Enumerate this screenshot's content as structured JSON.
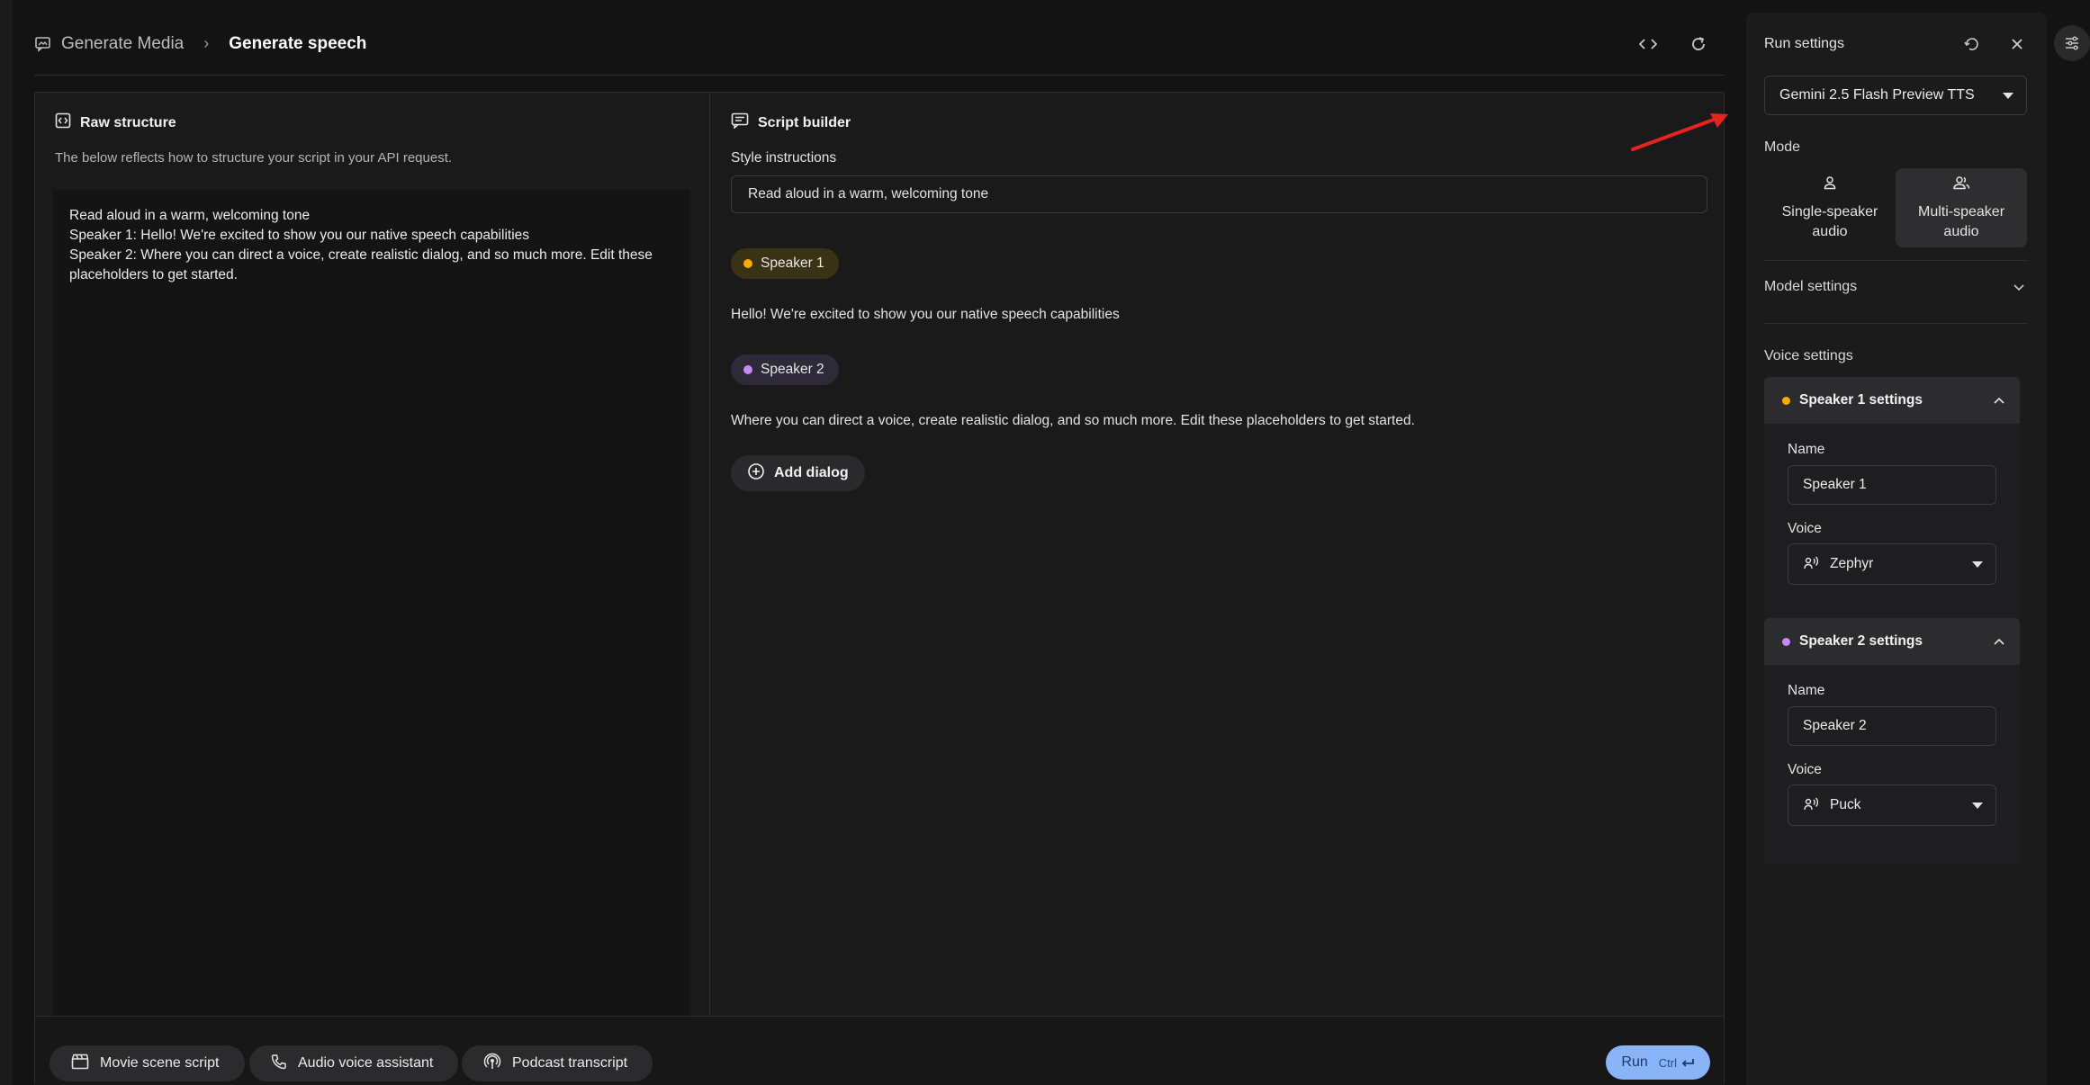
{
  "header": {
    "parent_label": "Generate Media",
    "parent_icon": "image-chat-icon",
    "current_label": "Generate speech",
    "actions": [
      "code-icon",
      "refresh-icon"
    ]
  },
  "raw_structure": {
    "title": "Raw structure",
    "description": "The below reflects how to structure your script in your API request.",
    "lines": [
      "Read aloud in a warm, welcoming tone",
      "Speaker 1: Hello! We're excited to show you our native speech capabilities",
      "Speaker 2: Where you can direct a voice, create realistic dialog, and so much more. Edit these placeholders to get started."
    ]
  },
  "script_builder": {
    "title": "Script builder",
    "style_label": "Style instructions",
    "style_value": "Read aloud in a warm, welcoming tone",
    "dialogs": [
      {
        "speaker": "Speaker 1",
        "color": "#f9ab00",
        "text": "Hello! We're excited to show you our native speech capabilities"
      },
      {
        "speaker": "Speaker 2",
        "color": "#c58af9",
        "text": "Where you can direct a voice, create realistic dialog, and so much more. Edit these placeholders to get started."
      }
    ],
    "add_dialog_label": "Add dialog"
  },
  "bottom_bar": {
    "presets": [
      {
        "label": "Movie scene script",
        "icon": "clapperboard-icon"
      },
      {
        "label": "Audio voice assistant",
        "icon": "phone-icon"
      },
      {
        "label": "Podcast transcript",
        "icon": "podcast-icon"
      }
    ],
    "run_label": "Run",
    "run_shortcut": "Ctrl"
  },
  "run_settings": {
    "title": "Run settings",
    "model": "Gemini 2.5 Flash Preview TTS",
    "mode_label": "Mode",
    "modes": [
      {
        "label_line1": "Single-speaker",
        "label_line2": "audio",
        "selected": false
      },
      {
        "label_line1": "Multi-speaker",
        "label_line2": "audio",
        "selected": true
      }
    ],
    "model_settings_label": "Model settings",
    "voice_settings_label": "Voice settings",
    "speakers": [
      {
        "title": "Speaker 1 settings",
        "color": "#f9ab00",
        "name_label": "Name",
        "name_value": "Speaker 1",
        "voice_label": "Voice",
        "voice_value": "Zephyr"
      },
      {
        "title": "Speaker 2 settings",
        "color": "#c58af9",
        "name_label": "Name",
        "name_value": "Speaker 2",
        "voice_label": "Voice",
        "voice_value": "Puck"
      }
    ]
  },
  "colors": {
    "accent_run": "#8ab4f8",
    "annotation_arrow": "#e8231f"
  }
}
